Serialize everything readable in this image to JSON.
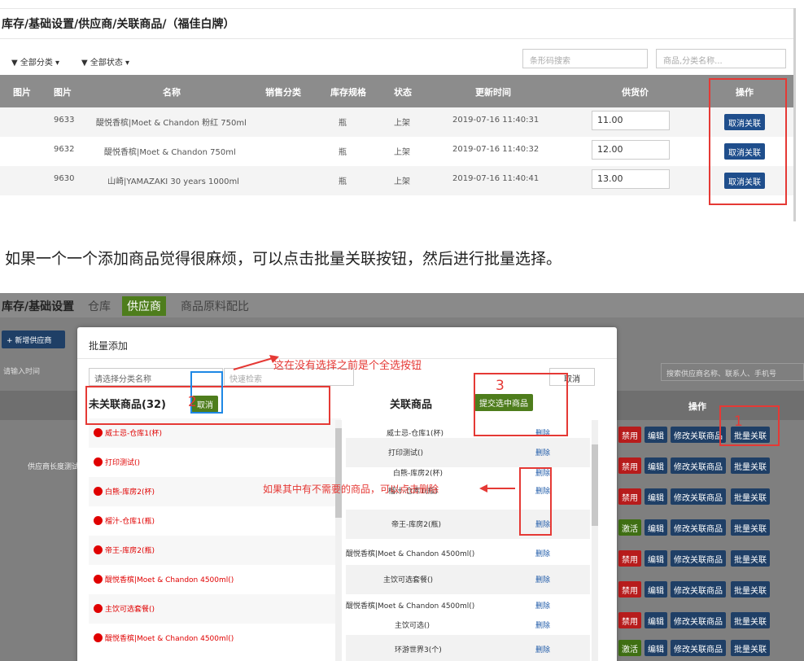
{
  "shot1": {
    "breadcrumb": "库存/基础设置/供应商/关联商品/（福佳白牌）",
    "filter_category": "▼ 全部分类 ▾",
    "filter_status": "▼ 全部状态 ▾",
    "search_barcode_placeholder": "条形码搜索",
    "search_name_placeholder": "商品,分类名称...",
    "columns": [
      "图片",
      "图片",
      "名称",
      "销售分类",
      "库存规格",
      "状态",
      "更新时间",
      "供货价",
      "操作"
    ],
    "rows": [
      {
        "id": "9633",
        "name": "醍悦香槟|Moet & Chandon 粉红 750ml",
        "unit": "瓶",
        "status": "上架",
        "updated": "2019-07-16 11:40:31",
        "price": "11.00",
        "action": "取消关联"
      },
      {
        "id": "9632",
        "name": "醍悦香槟|Moet & Chandon 750ml",
        "unit": "瓶",
        "status": "上架",
        "updated": "2019-07-16 11:40:32",
        "price": "12.00",
        "action": "取消关联"
      },
      {
        "id": "9630",
        "name": "山崎|YAMAZAKI 30 years 1000ml",
        "unit": "瓶",
        "status": "上架",
        "updated": "2019-07-16 11:40:41",
        "price": "13.00",
        "action": "取消关联"
      }
    ]
  },
  "caption": "如果一个一个添加商品觉得很麻烦，可以点击批量关联按钮，然后进行批量选择。",
  "shot2": {
    "breadcrumb": "库存/基础设置",
    "tabs": [
      "仓库",
      "供应商",
      "商品原料配比"
    ],
    "add_supplier": "+ 新增供应商",
    "date_placeholder": "请输入时间",
    "search_supplier": "搜索供应商名称、联系人、手机号",
    "ops_header": "操作",
    "bg_row_label": "供应商长度测试",
    "bg_actions": {
      "disable": "禁用",
      "activate": "激活",
      "edit": "编辑",
      "modify": "修改关联商品",
      "batch": "批量关联"
    },
    "modal": {
      "title": "批量添加",
      "category_placeholder": "请选择分类名称",
      "quick_search": "快速检索",
      "cancel": "取消",
      "unlinked_title": "未关联商品(32)",
      "select_toggle": "取消",
      "linked_title": "关联商品",
      "submit": "提交选中商品",
      "unlinked_items": [
        "威士忌-仓库1(杯)",
        "打印测试()",
        "白熊-库房2(杯)",
        "榴汁-仓库1(瓶)",
        "帝王-库房2(瓶)",
        "醍悦香槟|Moet & Chandon 4500ml()",
        "主饮可选套餐()",
        "醍悦香槟|Moet & Chandon 4500ml()"
      ],
      "linked_items": [
        "威士忌-仓库1(杯)",
        "打印测试()",
        "白熊-库房2(杯)",
        "榴汁-仓库1(瓶)",
        "帝王-库房2(瓶)",
        "醍悦香槟|Moet & Chandon 4500ml()",
        "主饮可选套餐()",
        "醍悦香槟|Moet & Chandon 4500ml()",
        "主饮可选()",
        "环游世界3(个)"
      ],
      "delete": "删除"
    },
    "annotations": {
      "select_all": "这在没有选择之前是个全选按钮",
      "delete_hint": "如果其中有不需要的商品，可以点击删除",
      "n1": "1",
      "n2": "2",
      "n3": "3"
    }
  }
}
